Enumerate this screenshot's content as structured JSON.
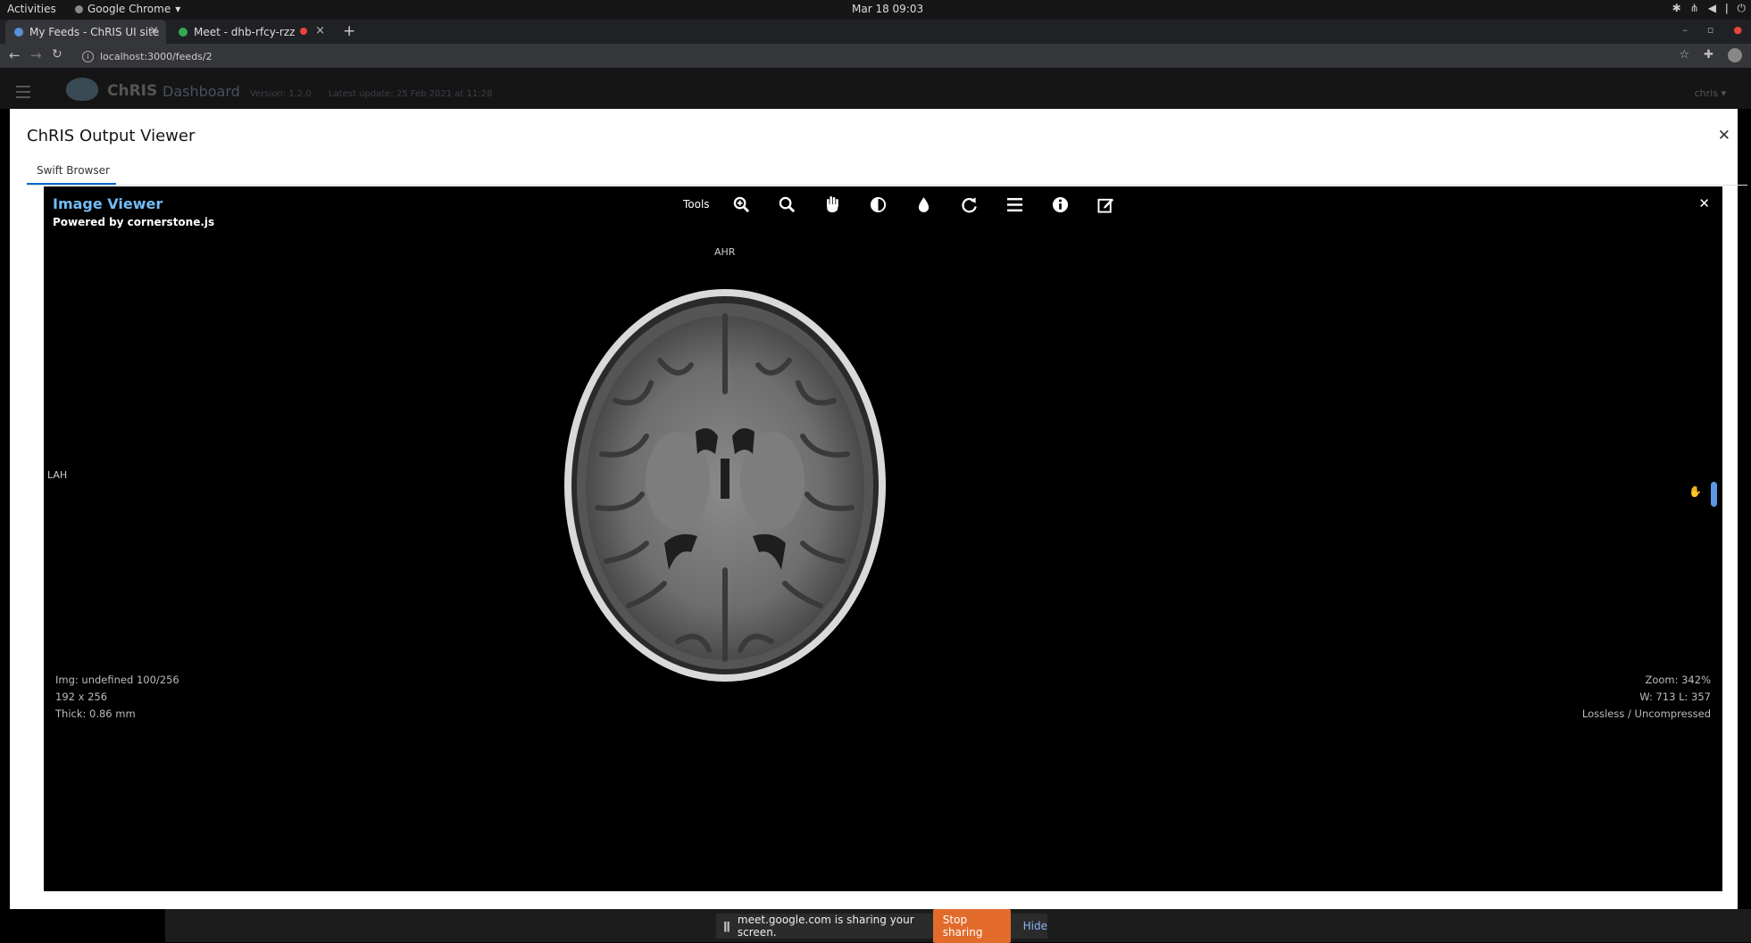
{
  "system": {
    "activities": "Activities",
    "app_name": "Google Chrome",
    "clock": "Mar 18  09:03"
  },
  "browser": {
    "tabs": [
      {
        "label": "My Feeds - ChRIS UI site"
      },
      {
        "label": "Meet - dhb-rfcy-rzz"
      }
    ],
    "url": "localhost:3000/feeds/2"
  },
  "dashboard": {
    "brand": "ChRIS",
    "brand_sub": "Dashboard",
    "version": "Version: 1.2.0",
    "last_update": "Latest update: 25 Feb 2021 at 11:28",
    "user": "chris"
  },
  "modal": {
    "title": "ChRIS Output Viewer",
    "tab": "Swift Browser"
  },
  "viewer": {
    "title": "Image Viewer",
    "subtitle": "Powered by cornerstone.js",
    "tools_label": "Tools",
    "tools": [
      "zoom-icon",
      "search-icon",
      "pan-hand-icon",
      "contrast-icon",
      "color-drop-icon",
      "rotate-icon",
      "menu-icon",
      "info-icon",
      "edit-icon"
    ],
    "orientation_top": "AHR",
    "orientation_left": "LAH",
    "bottom_left": {
      "img": "Img: undefined 100/256",
      "dims": "192 x 256",
      "thick": "Thick: 0.86 mm"
    },
    "bottom_right": {
      "zoom": "Zoom: 342%",
      "wl": "W: 713 L: 357",
      "compression": "Lossless / Uncompressed"
    }
  },
  "share": {
    "message": "meet.google.com is sharing your screen.",
    "stop": "Stop sharing",
    "hide": "Hide"
  }
}
